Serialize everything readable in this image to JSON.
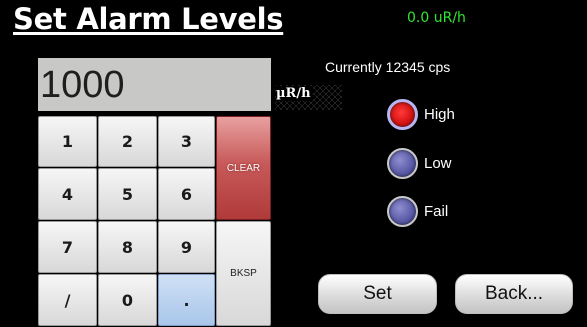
{
  "title": "Set Alarm Levels",
  "rate_readout": "0.0 uR/h",
  "status_text": "Currently 12345 cps",
  "entry": {
    "value": "1000",
    "unit": "µR/h"
  },
  "keypad": {
    "keys": [
      "1",
      "2",
      "3",
      "4",
      "5",
      "6",
      "7",
      "8",
      "9",
      "/",
      "0",
      "."
    ],
    "clear_label": "CLEAR",
    "backspace_label": "BKSP"
  },
  "alarm_levels": {
    "selected": "High",
    "options": [
      {
        "label": "High"
      },
      {
        "label": "Low"
      },
      {
        "label": "Fail"
      }
    ]
  },
  "buttons": {
    "set_label": "Set",
    "back_label": "Back..."
  }
}
